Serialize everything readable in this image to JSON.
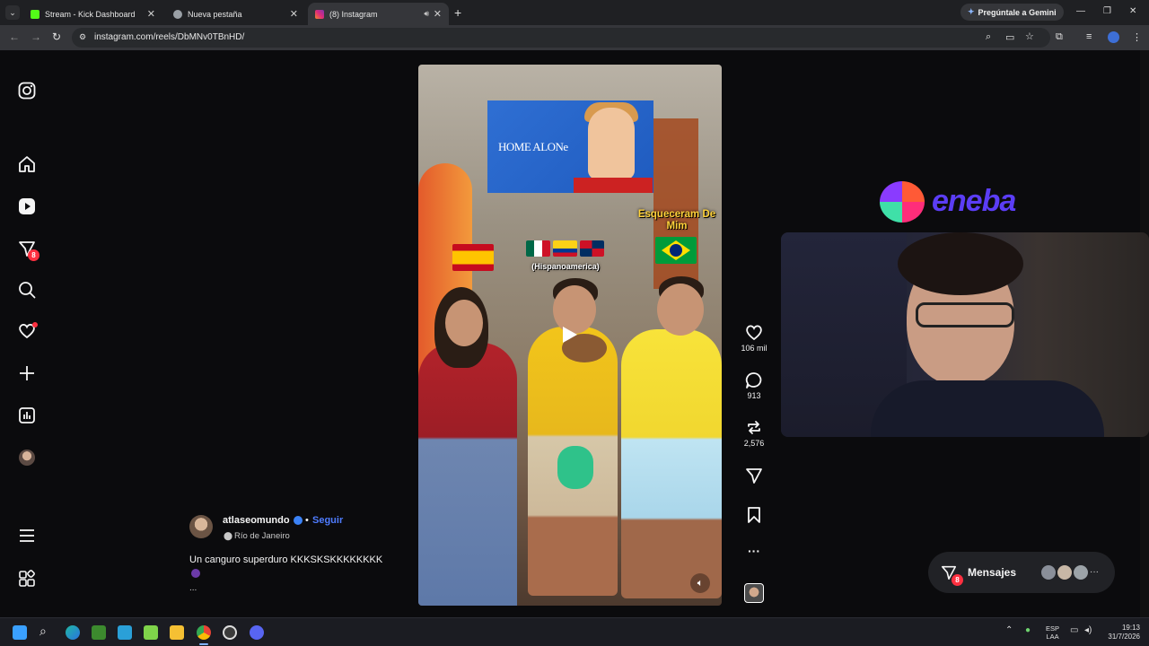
{
  "browser": {
    "tabs": [
      {
        "title": "Stream - Kick Dashboard",
        "favicon_color": "#53fc18",
        "active": false
      },
      {
        "title": "Nueva pestaña",
        "favicon_color": "#9aa0a6",
        "active": false
      },
      {
        "title": "(8) Instagram",
        "favicon_color": "#e1306c",
        "active": true
      }
    ],
    "gemini_label": "Pregúntale a Gemini",
    "url": "instagram.com/reels/DbMNv0TBnHD/"
  },
  "sidebar": {
    "items": [
      {
        "name": "instagram-logo",
        "icon": "instagram-icon"
      },
      {
        "name": "home",
        "icon": "home-icon"
      },
      {
        "name": "reels",
        "icon": "reels-icon"
      },
      {
        "name": "messages",
        "icon": "messenger-icon",
        "badge": "8"
      },
      {
        "name": "search",
        "icon": "search-icon"
      },
      {
        "name": "notifications",
        "icon": "heart-icon"
      },
      {
        "name": "create",
        "icon": "plus-icon"
      },
      {
        "name": "dashboard",
        "icon": "chart-icon"
      },
      {
        "name": "profile",
        "icon": "avatar"
      },
      {
        "name": "more",
        "icon": "menu-icon"
      },
      {
        "name": "also-from-meta",
        "icon": "apps-icon"
      }
    ]
  },
  "video": {
    "poster_title": "HOME ALONe",
    "caption_right": "Esqueceram De Mim",
    "caption_center": "(Hispanoamerica)"
  },
  "actions": {
    "likes": "106 mil",
    "comments": "913",
    "reposts": "2,576"
  },
  "post": {
    "author": "atlaseomundo",
    "follow_label": "Seguir",
    "location": "Río de Janeiro",
    "caption": "Un canguro superduro KKKSKSKKKKKKKK",
    "more": "..."
  },
  "messages": {
    "label": "Mensajes",
    "badge": "8",
    "more": "···"
  },
  "overlay": {
    "sponsor": "eneba"
  },
  "taskbar": {
    "lang_line1": "ESP",
    "lang_line2": "LAA",
    "time": "19:13",
    "date": "31/7/2026"
  },
  "colors": {
    "accent_blue": "#4f7cff",
    "badge_red": "#ff3040",
    "page_bg": "#0b0b0d"
  }
}
